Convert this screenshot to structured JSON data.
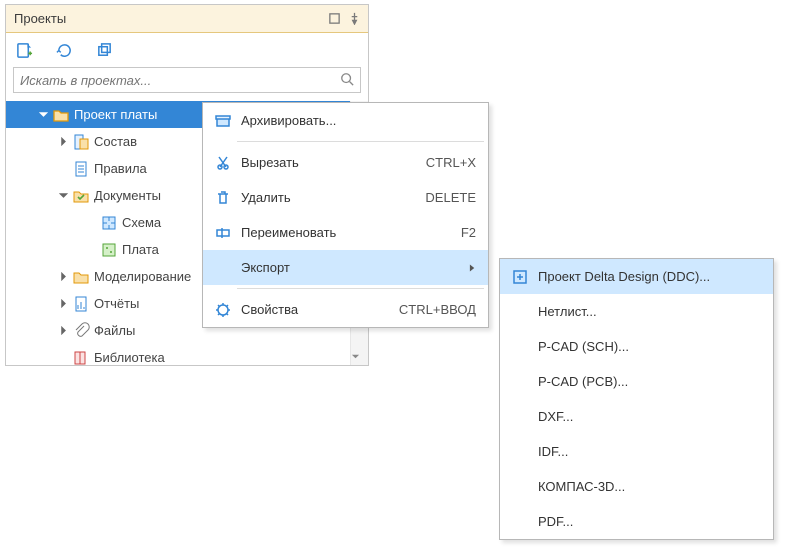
{
  "panel": {
    "title": "Проекты"
  },
  "search": {
    "placeholder": "Искать в проектах..."
  },
  "tree": {
    "root": "Проект платы",
    "items": [
      {
        "label": "Состав",
        "depth": 1,
        "chevron": "right",
        "icon": "composition"
      },
      {
        "label": "Правила",
        "depth": 1,
        "chevron": "",
        "icon": "rules"
      },
      {
        "label": "Документы",
        "depth": 1,
        "chevron": "down",
        "icon": "folder-check"
      },
      {
        "label": "Схема",
        "depth": 2,
        "chevron": "",
        "icon": "schematic"
      },
      {
        "label": "Плата",
        "depth": 2,
        "chevron": "",
        "icon": "board"
      },
      {
        "label": "Моделирование",
        "depth": 1,
        "chevron": "right",
        "icon": "folder"
      },
      {
        "label": "Отчёты",
        "depth": 1,
        "chevron": "right",
        "icon": "reports"
      },
      {
        "label": "Файлы",
        "depth": 1,
        "chevron": "right",
        "icon": "clip"
      },
      {
        "label": "Библиотека",
        "depth": 1,
        "chevron": "",
        "icon": "books"
      }
    ]
  },
  "menu1": [
    {
      "label": "Архивировать...",
      "icon": "archive",
      "shortcut": "",
      "submenu": false
    },
    {
      "sep": true
    },
    {
      "label": "Вырезать",
      "icon": "cut",
      "shortcut": "CTRL+X",
      "submenu": false
    },
    {
      "label": "Удалить",
      "icon": "trash",
      "shortcut": "DELETE",
      "submenu": false
    },
    {
      "label": "Переименовать",
      "icon": "rename",
      "shortcut": "F2",
      "submenu": false
    },
    {
      "label": "Экспорт",
      "icon": "",
      "shortcut": "",
      "submenu": true,
      "highlight": true
    },
    {
      "sep": true
    },
    {
      "label": "Свойства",
      "icon": "props",
      "shortcut": "CTRL+ВВОД",
      "submenu": false
    }
  ],
  "menu2": [
    {
      "label": "Проект Delta Design (DDC)...",
      "icon": "ddc",
      "highlight": true
    },
    {
      "label": "Нетлист...",
      "icon": ""
    },
    {
      "label": "P-CAD (SCH)...",
      "icon": ""
    },
    {
      "label": "P-CAD (PCB)...",
      "icon": ""
    },
    {
      "label": "DXF...",
      "icon": ""
    },
    {
      "label": "IDF...",
      "icon": ""
    },
    {
      "label": "КОМПАС-3D...",
      "icon": ""
    },
    {
      "label": "PDF...",
      "icon": ""
    }
  ]
}
